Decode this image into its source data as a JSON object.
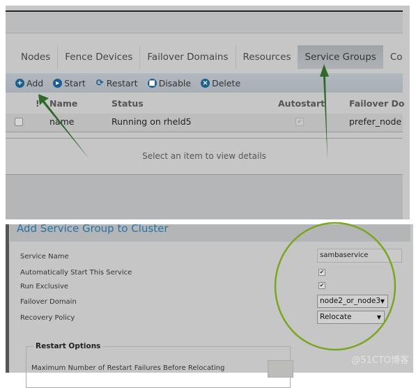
{
  "tabs": [
    "Nodes",
    "Fence Devices",
    "Failover Domains",
    "Resources",
    "Service Groups",
    "Co"
  ],
  "active_tab": "Service Groups",
  "toolbar": {
    "add": "Add",
    "start": "Start",
    "restart": "Restart",
    "disable": "Disable",
    "delete": "Delete"
  },
  "table": {
    "headers": {
      "flag": "!",
      "name": "Name",
      "status": "Status",
      "autostart": "Autostart",
      "failover": "Failover Do"
    },
    "rows": [
      {
        "name": "name",
        "status": "Running on rheld5",
        "autostart": true,
        "failover": "prefer_node"
      }
    ]
  },
  "detail_text": "Select an item to view details",
  "form": {
    "title": "Add Service Group to Cluster",
    "service_name_label": "Service Name",
    "service_name_value": "sambaservice",
    "autostart_label": "Automatically Start This Service",
    "autostart_checked": true,
    "exclusive_label": "Run Exclusive",
    "exclusive_checked": true,
    "failover_label": "Failover Domain",
    "failover_value": "node2_or_node3",
    "recovery_label": "Recovery Policy",
    "recovery_value": "Relocate",
    "restart_legend": "Restart Options",
    "max_restart_label": "Maximum Number of Restart Failures Before Relocating"
  },
  "watermark": "@51CTO博客",
  "colors": {
    "arrow": "#2e6b2a",
    "circle": "#7aa61e",
    "title": "#2574a9",
    "icon": "#1d5e91"
  }
}
